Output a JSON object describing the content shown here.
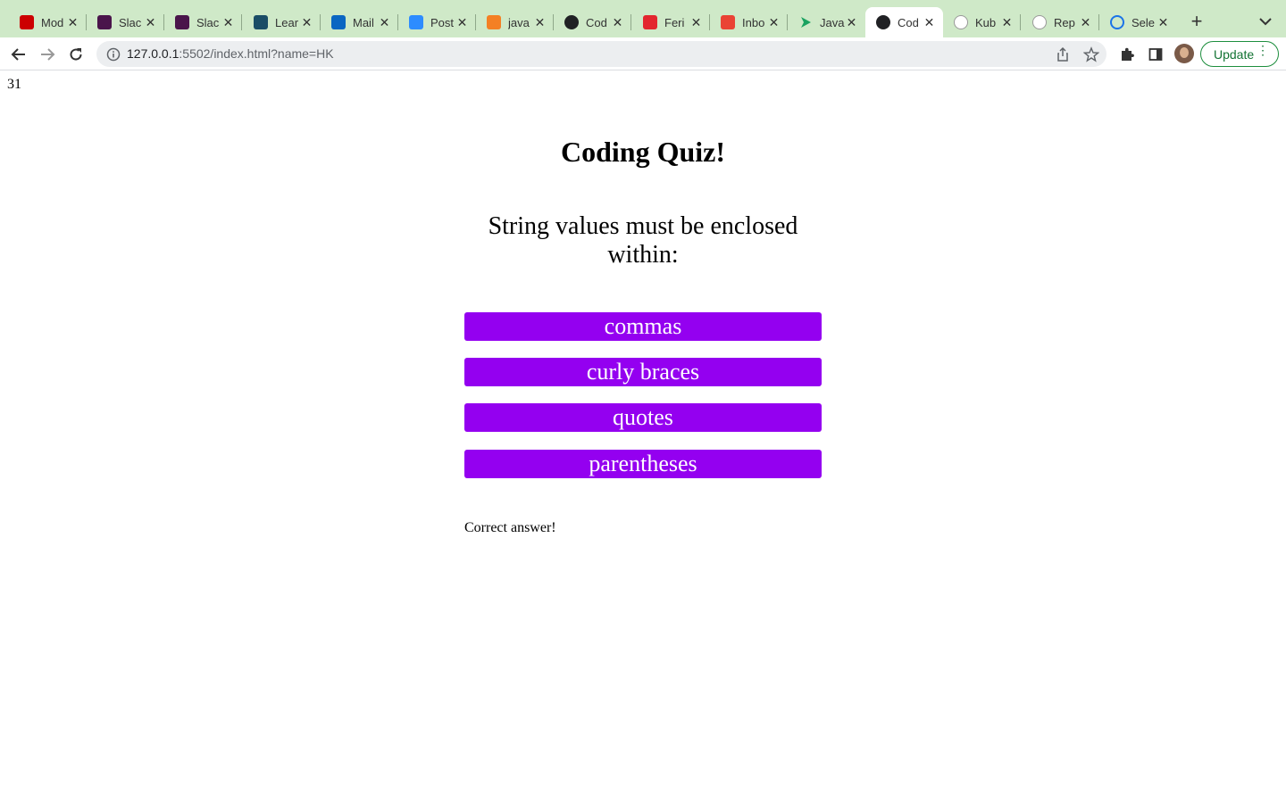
{
  "browser": {
    "tabs": [
      {
        "title": "Mod",
        "icon": "university-u-icon",
        "color": "#cc0000"
      },
      {
        "title": "Slac",
        "icon": "slack-icon",
        "color": "#4a154b"
      },
      {
        "title": "Slac",
        "icon": "slack-icon",
        "color": "#4a154b"
      },
      {
        "title": "Lear",
        "icon": "learn-icon",
        "color": "#1a4d66"
      },
      {
        "title": "Mail",
        "icon": "outlook-icon",
        "color": "#0a66c2"
      },
      {
        "title": "Post",
        "icon": "zoom-icon",
        "color": "#2d8cff"
      },
      {
        "title": "java",
        "icon": "stackoverflow-icon",
        "color": "#f48024"
      },
      {
        "title": "Cod",
        "icon": "globe-icon",
        "color": "#202124"
      },
      {
        "title": "Feri",
        "icon": "shield-icon",
        "color": "#e3262e"
      },
      {
        "title": "Inbo",
        "icon": "gmail-icon",
        "color": "#ea4335"
      },
      {
        "title": "Java",
        "icon": "play-arrow-icon",
        "color": "#1aa260"
      },
      {
        "title": "Cod",
        "icon": "globe-icon",
        "color": "#202124",
        "active": true
      },
      {
        "title": "Kub",
        "icon": "github-icon",
        "color": "#ffffff"
      },
      {
        "title": "Rep",
        "icon": "github-icon",
        "color": "#ffffff"
      },
      {
        "title": "Sele",
        "icon": "selenium-icon",
        "color": "#1a73e8"
      }
    ],
    "tab_close_glyph": "✕",
    "new_tab_glyph": "+",
    "url_host": "127.0.0.1",
    "url_rest": ":5502/index.html?name=HK",
    "update_label": "Update"
  },
  "page": {
    "timer": "31",
    "title": "Coding Quiz!",
    "question": "String values must be enclosed within:",
    "answers": [
      "commas",
      "curly braces",
      "quotes",
      "parentheses"
    ],
    "feedback": "Correct answer!",
    "button_color": "#9400f0"
  }
}
